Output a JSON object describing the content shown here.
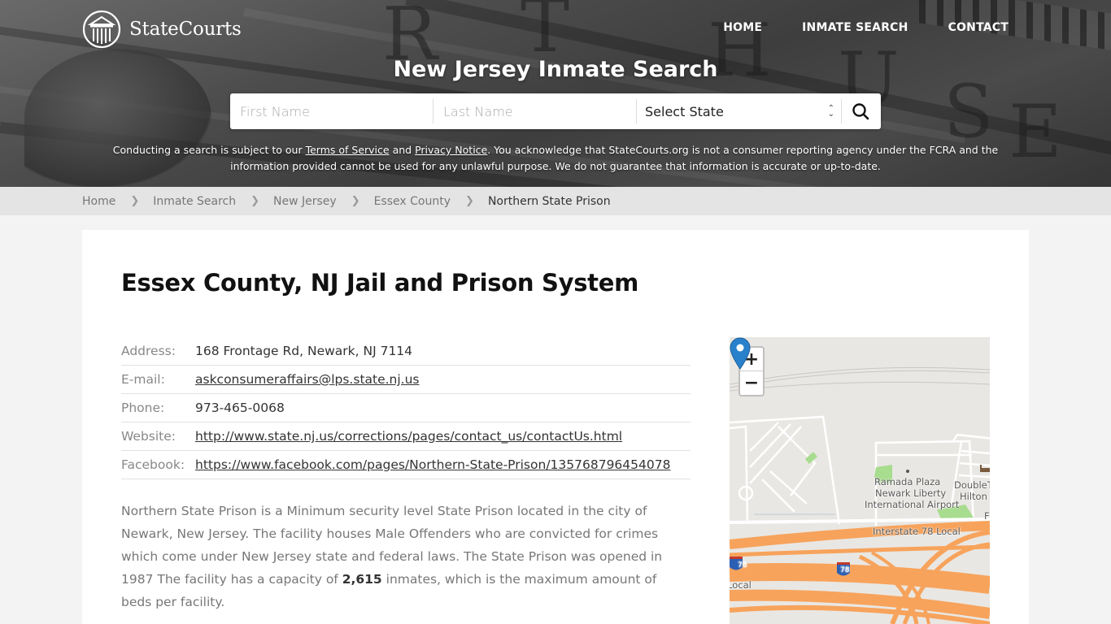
{
  "header": {
    "logo_text": "StateCourts",
    "nav": [
      {
        "label": "HOME"
      },
      {
        "label": "INMATE SEARCH"
      },
      {
        "label": "CONTACT"
      }
    ],
    "hero_title": "New Jersey Inmate Search",
    "search": {
      "first_name_placeholder": "First Name",
      "last_name_placeholder": "Last Name",
      "state_select_value": "Select State",
      "submit_icon": "search-icon"
    },
    "disclaimer": {
      "part1": "Conducting a search is subject to our ",
      "terms_link": "Terms of Service",
      "part2": " and ",
      "privacy_link": "Privacy Notice",
      "part3": ". You acknowledge that StateCourts.org is not a consumer reporting agency under the FCRA and the information provided cannot be used for any unlawful purpose. We do not guarantee that information is accurate or up-to-date."
    }
  },
  "breadcrumb": [
    {
      "label": "Home"
    },
    {
      "label": "Inmate Search"
    },
    {
      "label": "New Jersey"
    },
    {
      "label": "Essex County"
    },
    {
      "label": "Northern State Prison",
      "current": true
    }
  ],
  "main": {
    "title": "Essex County, NJ Jail and Prison System",
    "info": {
      "address_label": "Address:",
      "address_value": "168 Frontage Rd, Newark, NJ 7114",
      "email_label": "E-mail:",
      "email_value": "askconsumeraffairs@lps.state.nj.us",
      "phone_label": "Phone:",
      "phone_value": "973-465-0068",
      "website_label": "Website:",
      "website_value": "http://www.state.nj.us/corrections/pages/contact_us/contactUs.html",
      "facebook_label": "Facebook:",
      "facebook_value": "https://www.facebook.com/pages/Northern-State-Prison/135768796454078"
    },
    "description": {
      "text_before": "Northern State Prison is a Minimum security level State Prison located in the city of Newark, New Jersey. The facility houses Male Offenders who are convicted for crimes which come under New Jersey state and federal laws. The State Prison was opened in 1987 The facility has a capacity of ",
      "capacity": "2,615",
      "text_after": " inmates, which is the maximum amount of beds per facility."
    }
  },
  "map": {
    "zoom_in": "+",
    "zoom_out": "−",
    "labels": {
      "poi1_line1": "Ramada Plaza",
      "poi1_line2": "Newark Liberty",
      "poi1_line3": "International Airport",
      "poi2_line1": "DoubleT",
      "poi2_line2": "Hilton H",
      "road1": "Interstate 78 Local",
      "road2": "Local",
      "shield": "78",
      "edge_letter": "F"
    },
    "colors": {
      "highway": "#f7a35c",
      "park": "#a8dc8e",
      "pin": "#2a81cb",
      "ground": "#e9e7e3"
    }
  }
}
